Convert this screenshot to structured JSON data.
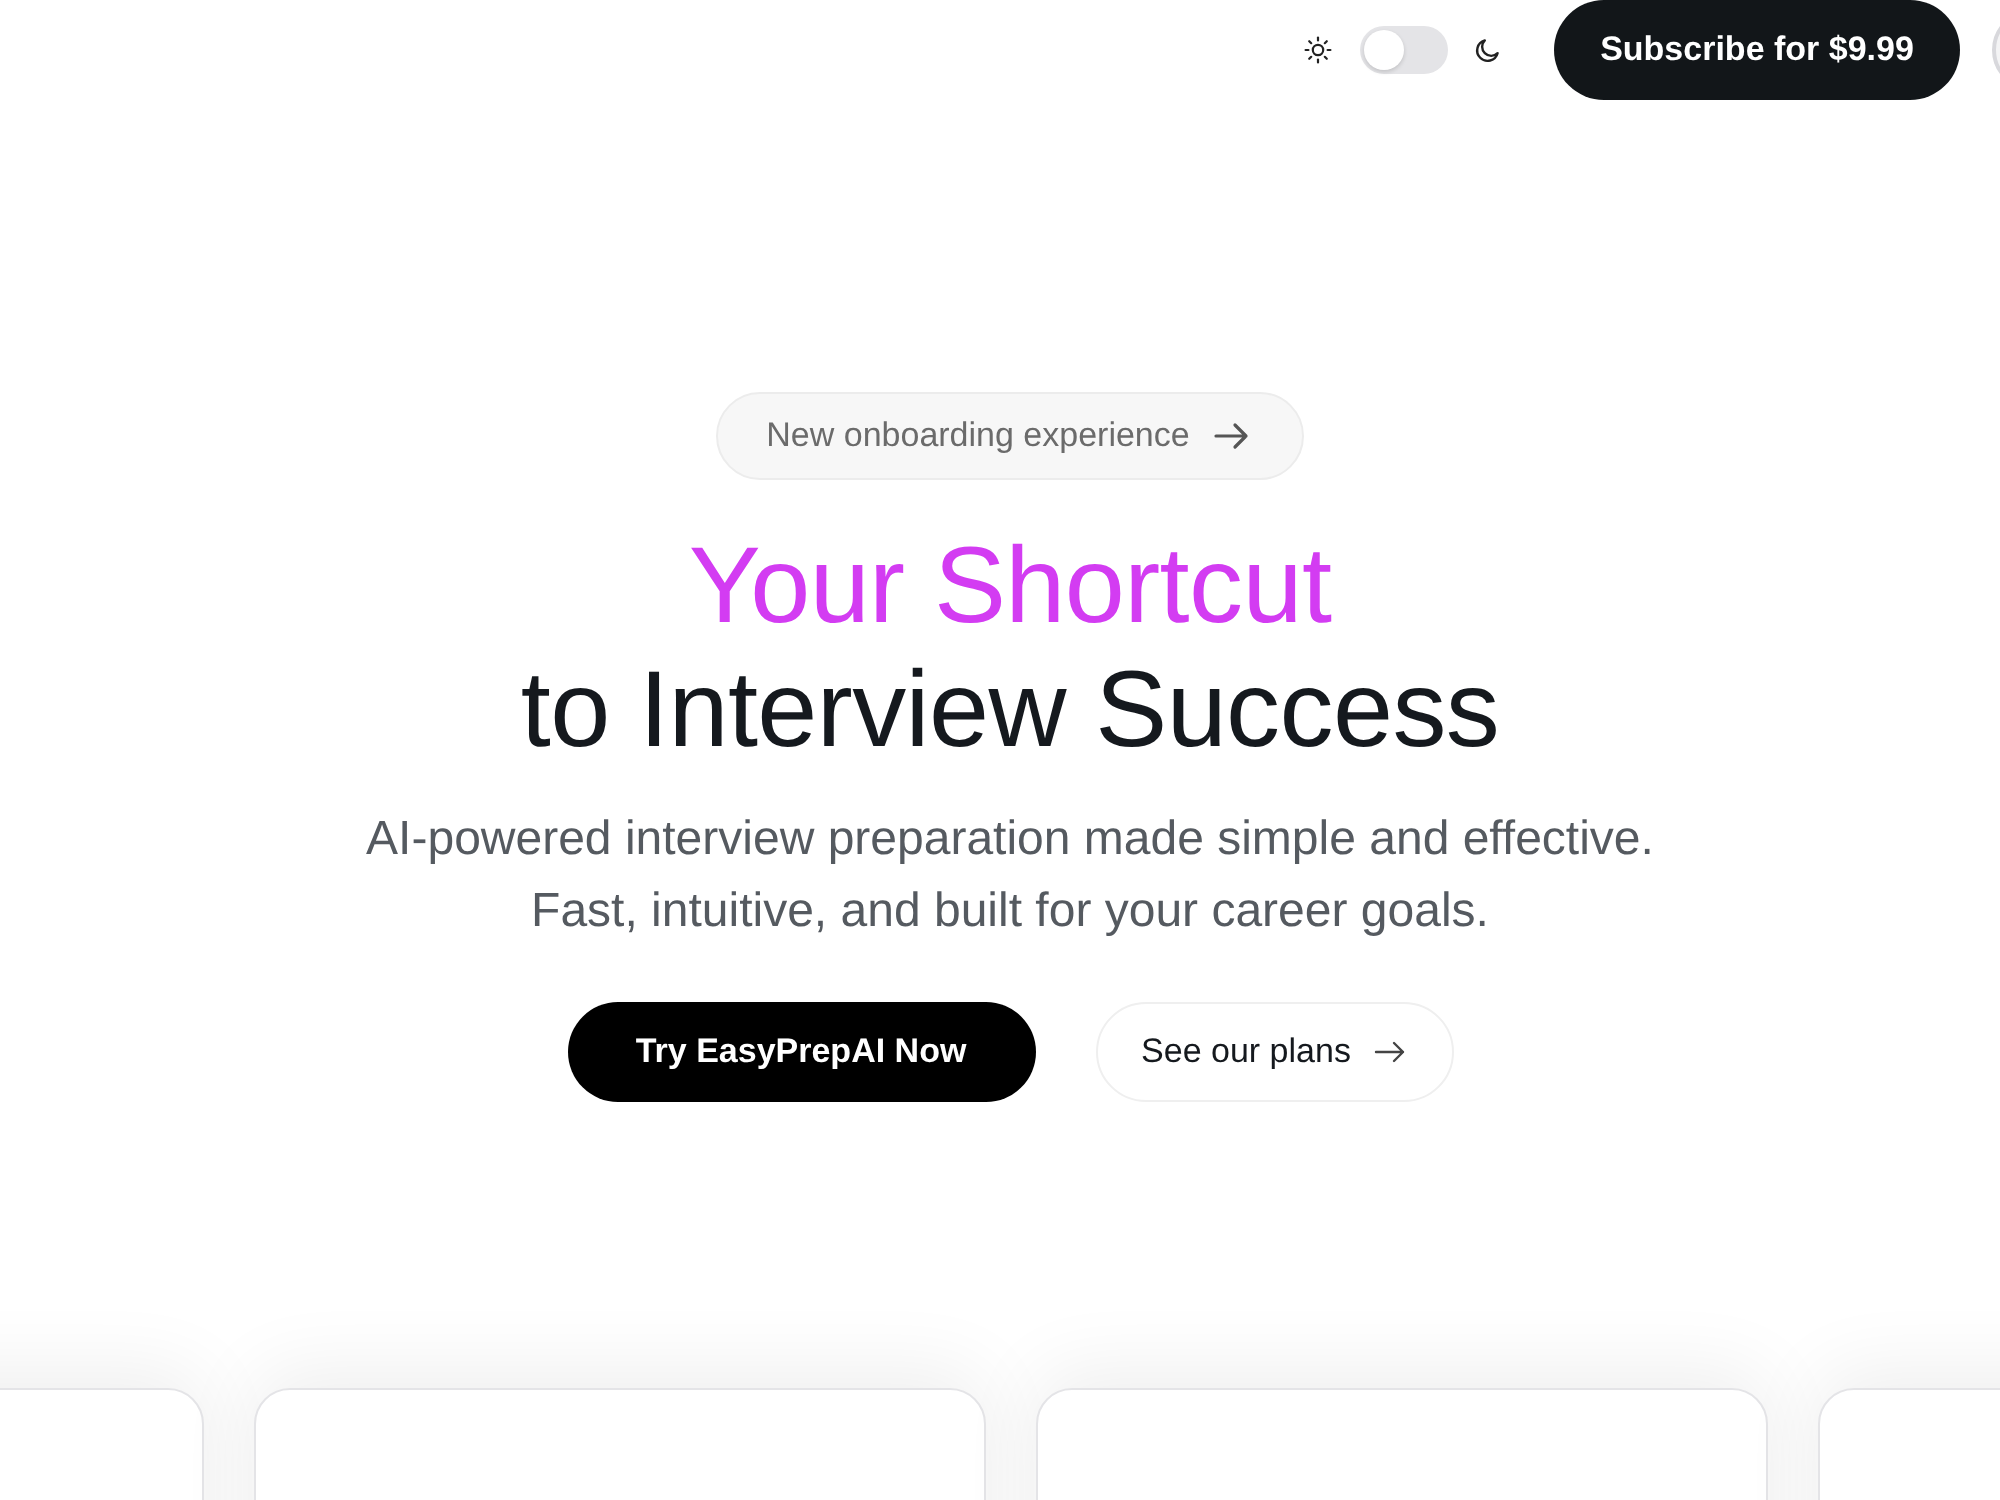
{
  "header": {
    "theme_toggle": {
      "on": false
    },
    "subscribe_button": "Subscribe for $9.99"
  },
  "hero": {
    "badge": "New onboarding experience",
    "headline": [
      {
        "text": "Your Shortcut",
        "kind": "accent"
      },
      {
        "text": "to Interview Success",
        "kind": "plain"
      }
    ],
    "subtitle": [
      "AI-powered interview preparation made simple and effective.",
      "Fast, intuitive, and built for your career goals."
    ],
    "buttons": [
      {
        "label": "Try EasyPrepAI Now",
        "kind": "primary"
      },
      {
        "label": "See our plans",
        "kind": "secondary"
      }
    ]
  }
}
